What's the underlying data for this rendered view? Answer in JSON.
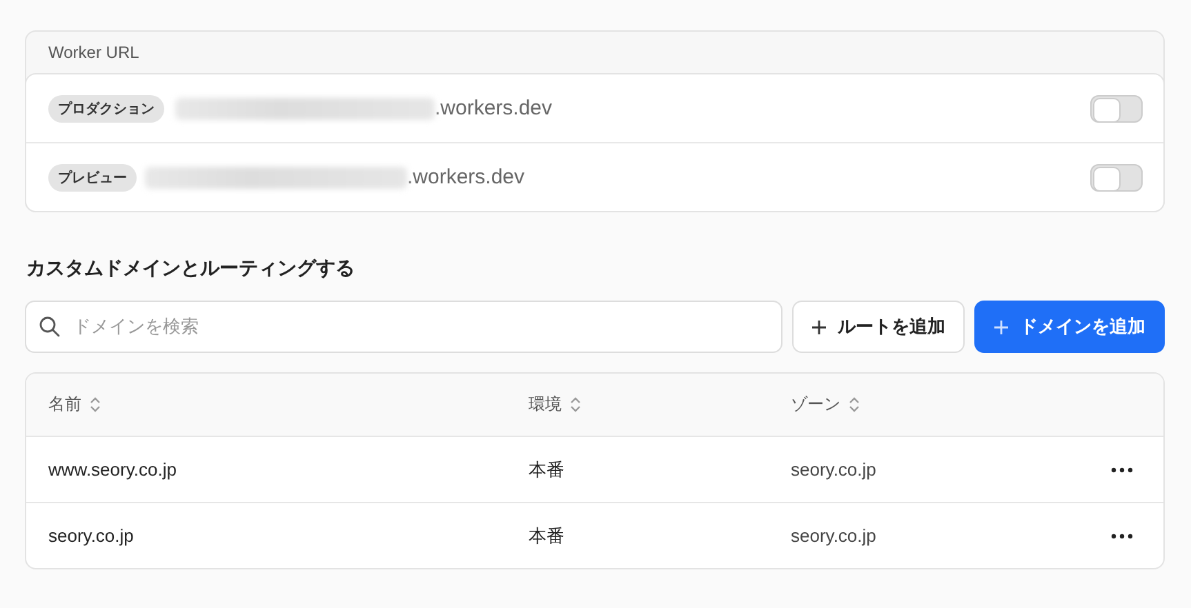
{
  "worker_url": {
    "title": "Worker URL",
    "rows": [
      {
        "badge": "プロダクション",
        "suffix": ".workers.dev",
        "on": false
      },
      {
        "badge": "プレビュー",
        "suffix": ".workers.dev",
        "on": false
      }
    ]
  },
  "custom_domains": {
    "title": "カスタムドメインとルーティングする",
    "search": {
      "placeholder": "ドメインを検索"
    },
    "buttons": [
      {
        "label": "ルートを追加",
        "kind": "secondary"
      },
      {
        "label": "ドメインを追加",
        "kind": "primary"
      }
    ],
    "table": {
      "columns": [
        "名前",
        "環境",
        "ゾーン"
      ],
      "rows": [
        [
          "www.seory.co.jp",
          "本番",
          "seory.co.jp"
        ],
        [
          "seory.co.jp",
          "本番",
          "seory.co.jp"
        ]
      ]
    }
  }
}
